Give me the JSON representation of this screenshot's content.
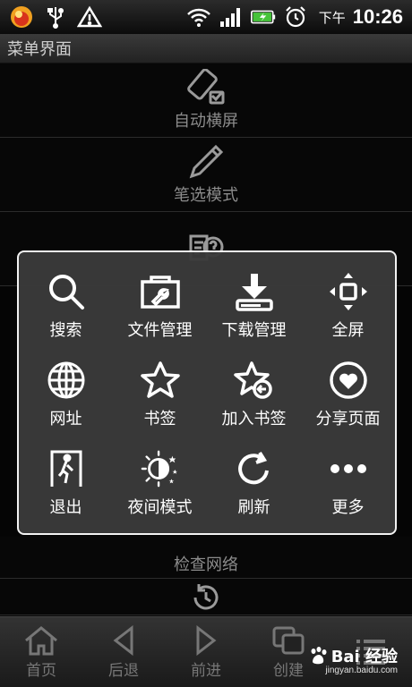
{
  "status_bar": {
    "ampm": "下午",
    "time": "10:26"
  },
  "title_bar": {
    "title": "菜单界面"
  },
  "background_list": [
    {
      "label": "自动横屏",
      "icon": "rotate-screen-icon"
    },
    {
      "label": "笔选模式",
      "icon": "pen-icon"
    },
    {
      "label": "",
      "icon": "help-document-icon"
    }
  ],
  "background_lower": [
    {
      "label": "检查网络",
      "icon": "network-check-icon"
    },
    {
      "label": "",
      "icon": "clock-refresh-icon"
    }
  ],
  "menu": {
    "items": [
      {
        "label": "搜索",
        "icon": "search-icon"
      },
      {
        "label": "文件管理",
        "icon": "folder-wrench-icon"
      },
      {
        "label": "下载管理",
        "icon": "download-icon"
      },
      {
        "label": "全屏",
        "icon": "fullscreen-icon"
      },
      {
        "label": "网址",
        "icon": "globe-icon"
      },
      {
        "label": "书签",
        "icon": "star-icon"
      },
      {
        "label": "加入书签",
        "icon": "add-bookmark-icon"
      },
      {
        "label": "分享页面",
        "icon": "share-heart-icon"
      },
      {
        "label": "退出",
        "icon": "exit-icon"
      },
      {
        "label": "夜间模式",
        "icon": "night-mode-icon"
      },
      {
        "label": "刷新",
        "icon": "refresh-icon"
      },
      {
        "label": "更多",
        "icon": "more-icon"
      }
    ]
  },
  "toolbar": {
    "home": "首页",
    "back": "后退",
    "forward": "前进",
    "create": "创建"
  },
  "watermark": {
    "text": "Bai 经验",
    "url": "jingyan.baidu.com"
  }
}
